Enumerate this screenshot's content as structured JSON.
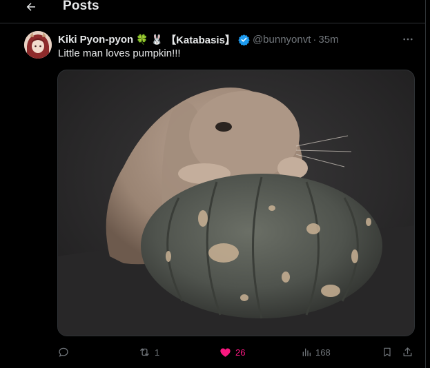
{
  "header": {
    "title": "Posts"
  },
  "post": {
    "author": {
      "display_name": "Kiki Pyon-pyon",
      "emoji_1": "🍀",
      "emoji_2": "🐰",
      "name_tag": "【Katabasis】",
      "handle": "@bunnyonvt",
      "time": "35m"
    },
    "separator": "·",
    "text": "Little man loves pumpkin!!!",
    "actions": {
      "reposts": "1",
      "likes": "26",
      "views": "168"
    }
  },
  "colors": {
    "like": "#f91880",
    "verified": "#1d9bf0",
    "muted": "#71767b"
  }
}
